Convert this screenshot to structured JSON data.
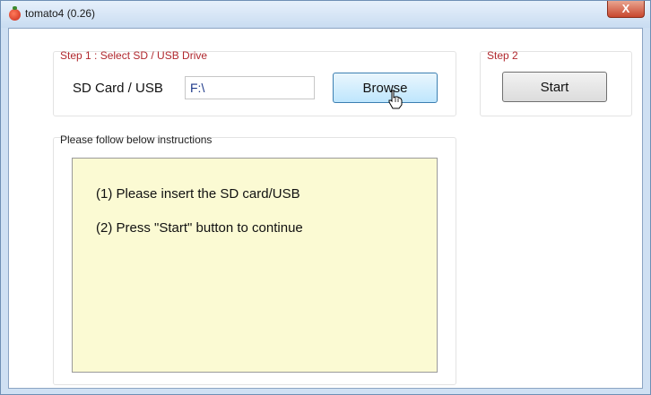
{
  "window": {
    "title": "tomato4 (0.26)",
    "close_glyph": "X",
    "app_icon": "tomato-icon"
  },
  "step1": {
    "caption": "Step 1 : Select SD / USB Drive",
    "field_label": "SD Card / USB",
    "drive_value": "F:\\",
    "browse_label": "Browse"
  },
  "step2": {
    "caption": "Step 2",
    "start_label": "Start"
  },
  "instructions": {
    "caption": "Please follow below instructions",
    "lines": [
      "(1) Please insert the SD card/USB",
      "(2) Press \"Start\" button to continue"
    ]
  },
  "colors": {
    "caption_red": "#b0282e",
    "instructions_bg": "#fbfad3",
    "drive_text": "#1f3a8a"
  }
}
